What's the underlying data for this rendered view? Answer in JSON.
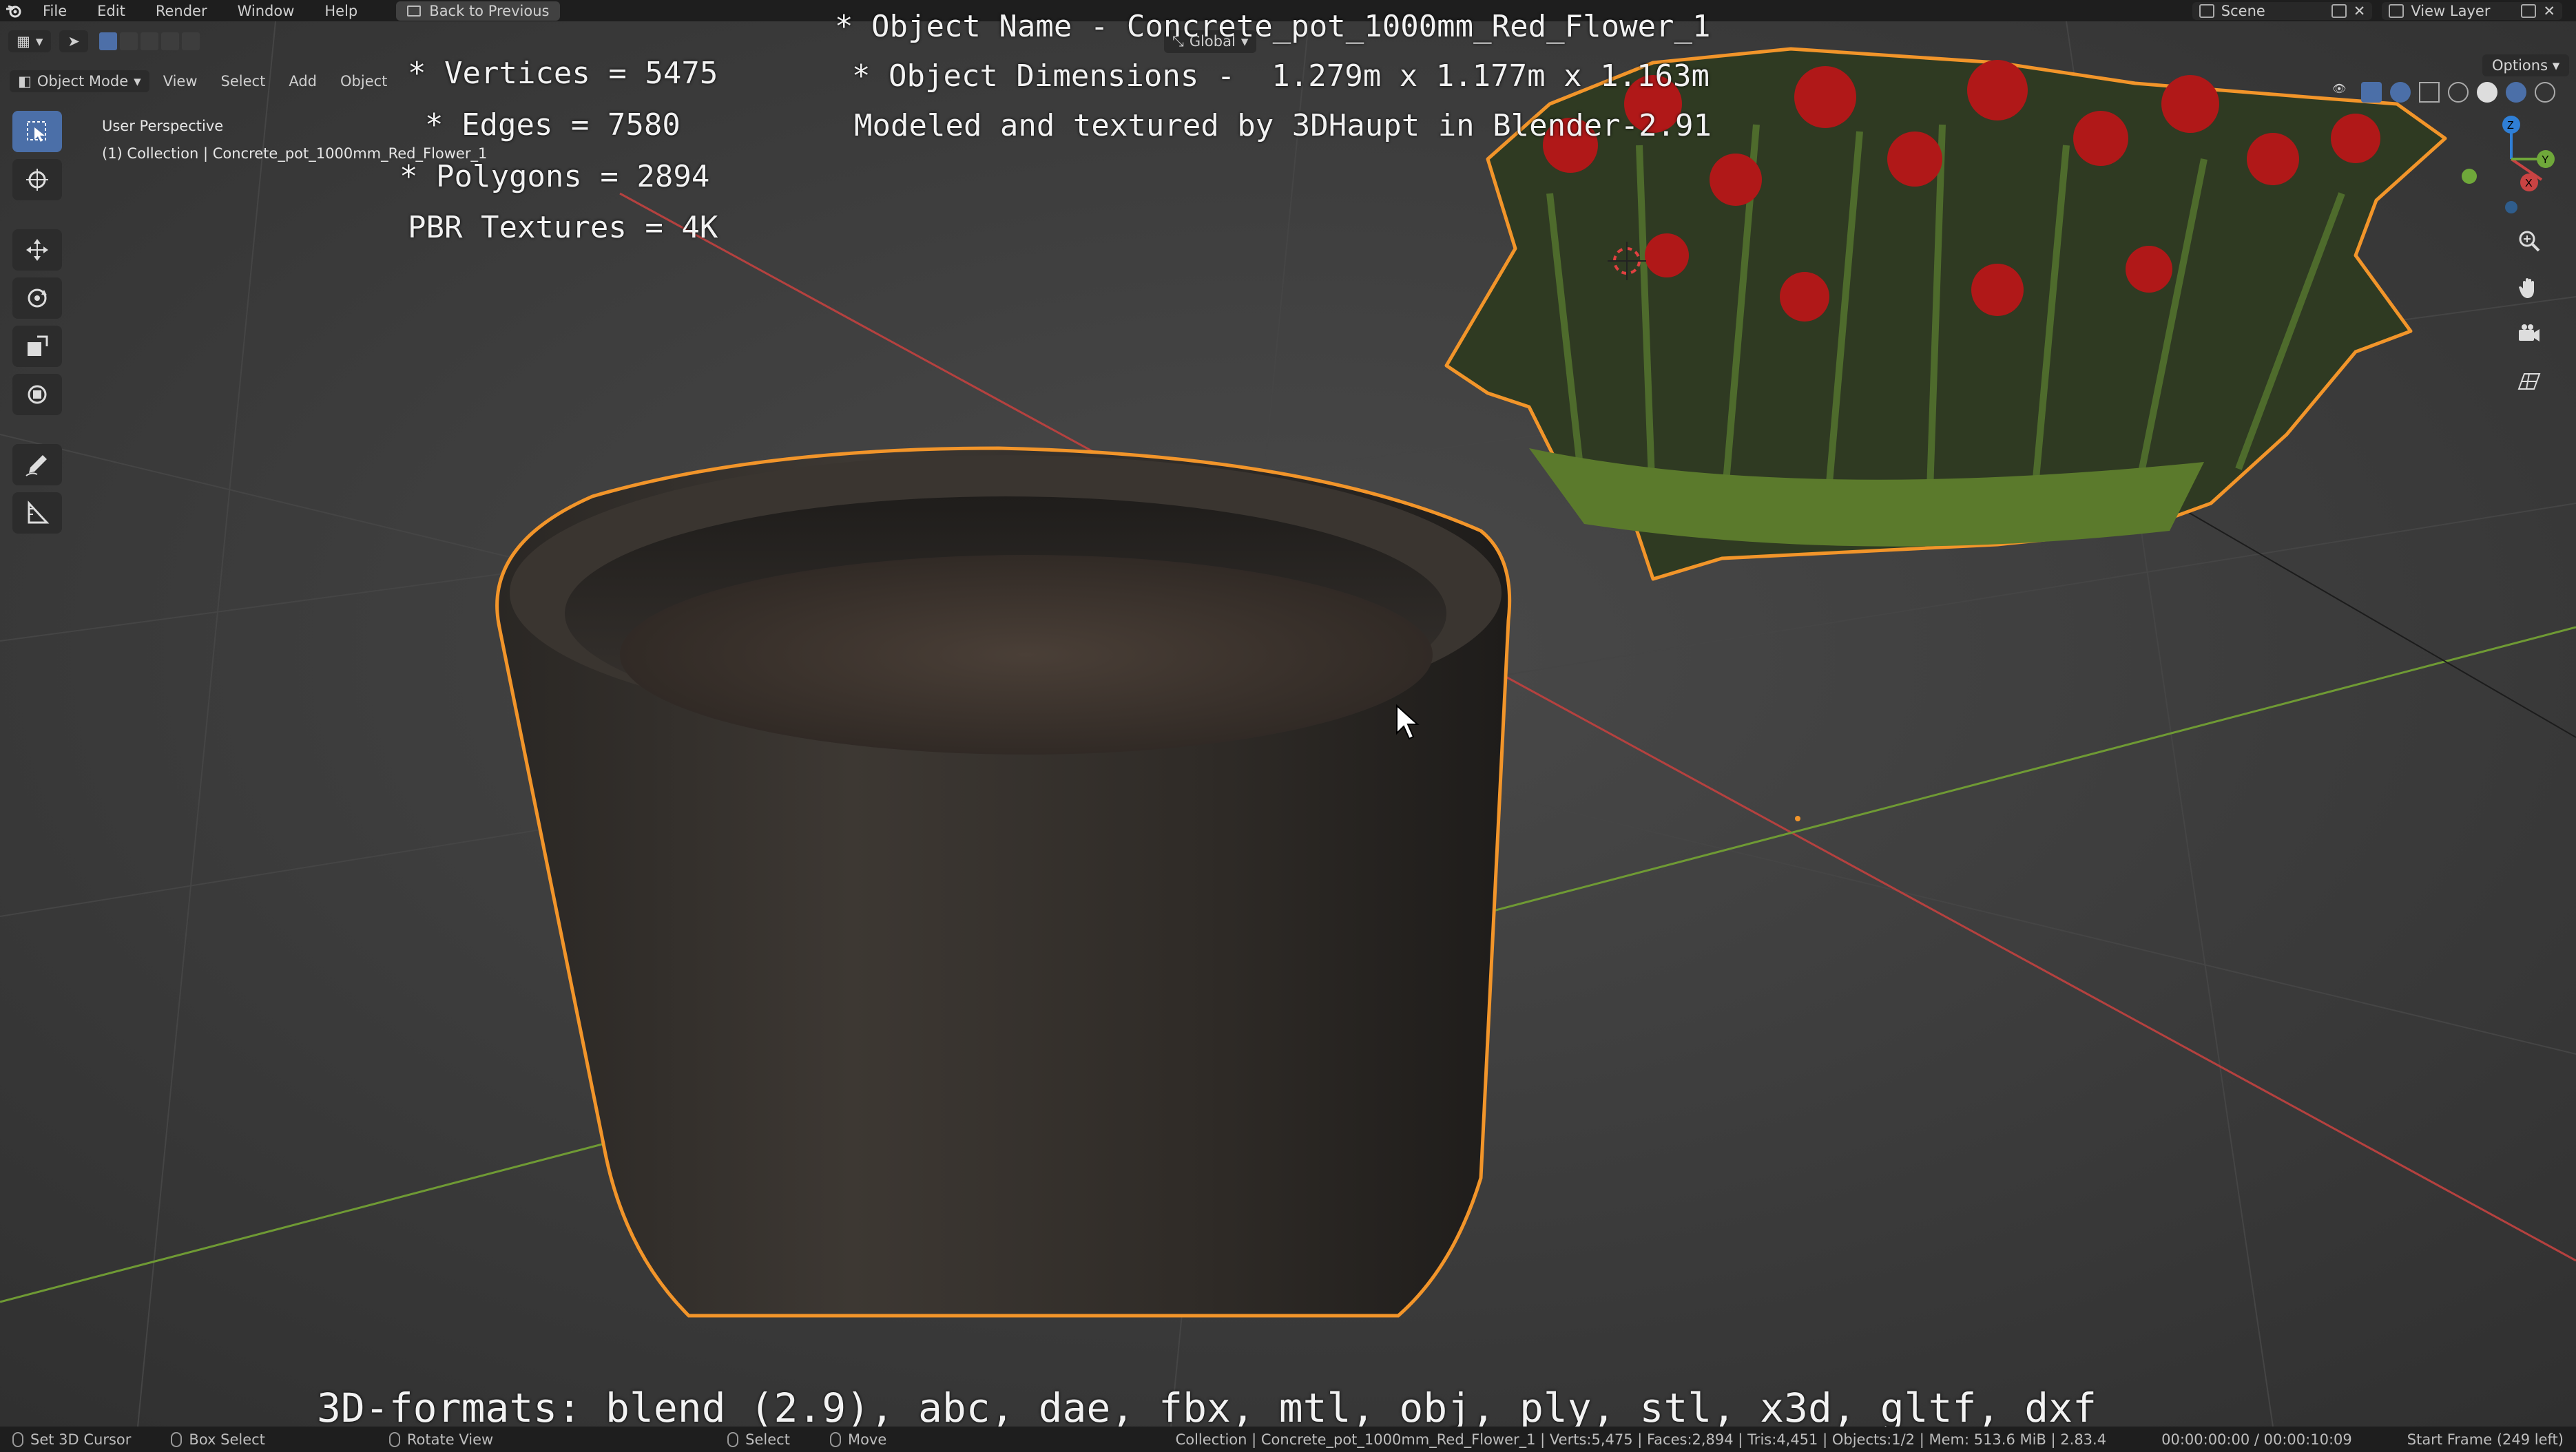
{
  "menubar": {
    "items": [
      "File",
      "Edit",
      "Render",
      "Window",
      "Help"
    ],
    "back_button": "Back to Previous",
    "scene": "Scene",
    "view_layer": "View Layer"
  },
  "viewport_header": {
    "mode": "Object Mode",
    "menus": [
      "View",
      "Select",
      "Add",
      "Object"
    ],
    "transform_orientation": "Global",
    "options": "Options"
  },
  "viewport_info": {
    "perspective": "User Perspective",
    "collection": "(1) Collection | Concrete_pot_1000mm_Red_Flower_1"
  },
  "overlay_text": {
    "vertices": "* Vertices = 5475",
    "edges": "* Edges = 7580",
    "polygons": "* Polygons = 2894",
    "textures": "PBR Textures = 4K",
    "object_name": "* Object Name - Concrete_pot_1000mm_Red_Flower_1",
    "dimensions": "* Object Dimensions -  1.279m x 1.177m x 1.163m",
    "credits": "Modeled and textured by 3DHaupt in Blender-2.91",
    "formats": "3D-formats: blend (2.9), abc, dae, fbx, mtl, obj, ply, stl, x3d, gltf, dxf"
  },
  "statusbar": {
    "hints": [
      "Set 3D Cursor",
      "Box Select",
      "Rotate View",
      "Select",
      "Move"
    ],
    "stats": "Collection | Concrete_pot_1000mm_Red_Flower_1 | Verts:5,475 | Faces:2,894 | Tris:4,451 | Objects:1/2 | Mem: 513.6 MiB | 2.83.4",
    "time": "00:00:00:00 / 00:00:10:09",
    "frame": "Start Frame (249 left)"
  },
  "colors": {
    "selection_outline": "#f2952a",
    "x_axis": "#b5413f",
    "y_axis": "#6f9a34",
    "active_tool": "#4b6fa8"
  }
}
